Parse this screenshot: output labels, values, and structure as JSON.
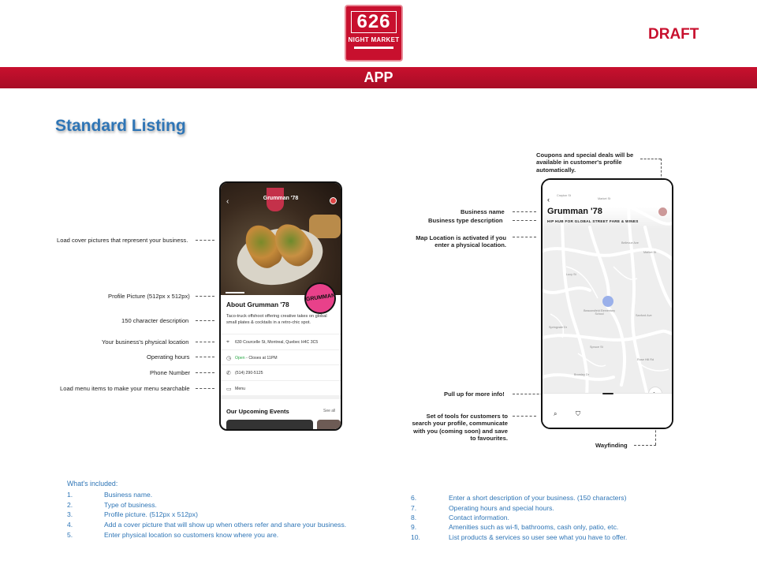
{
  "logo": {
    "number": "626",
    "subtitle": "NIGHT MARKET"
  },
  "draft_label": "DRAFT",
  "band_title": "APP",
  "heading": "Standard Listing",
  "left_callouts": [
    "Load cover pictures that represent your business.",
    "Profile Picture (512px x 512px)",
    "150 character description",
    "Your business's physical location",
    "Operating hours",
    "Phone Number",
    "Load menu items to make your menu searchable"
  ],
  "right_callouts": {
    "coupons": "Coupons and special deals will be available in customer's profile automatically.",
    "business_name": "Business name",
    "business_type": "Business type description",
    "map_location": "Map Location is activated if you enter a physical location.",
    "pull_up": "Pull up for more info!",
    "tools": "Set of tools for customers to search your profile, communicate with you (coming soon) and save to favourites.",
    "wayfinding": "Wayfinding"
  },
  "phone1": {
    "title": "Grumman '78",
    "about_title": "About Grumman '78",
    "description": "Taco-truck offshoot offering creative takes on global small plates & cocktails in a retro-chic spot.",
    "address": "630 Courcelle St, Montreal, Quebec H4C 3C5",
    "hours_status": "Open",
    "hours_detail": " - Closes at 11PM",
    "phone": "(514) 290-5125",
    "menu": "Menu",
    "events_title": "Our Upcoming Events",
    "see_all": "See all",
    "profile_badge": "GRUMMAN"
  },
  "phone2": {
    "business_name": "Grumman '78",
    "business_type": "HIP HUB FOR GLOBAL STREET FARE & WINES",
    "pin_label": "Beaconsfield Elementary School",
    "road_labels": [
      "Crayton St",
      "Market St",
      "Bellevue Ave",
      "Market St",
      "Lucy St",
      "Springvale Dr",
      "Spruce St",
      "Sanford Ave",
      "Rose Hill Rd",
      "Bromley Dr"
    ]
  },
  "included_title": "What's included:",
  "included_left": [
    {
      "n": "1.",
      "t": "Business name."
    },
    {
      "n": "2.",
      "t": "Type of business."
    },
    {
      "n": "3.",
      "t": "Profile picture. (512px x 512px)"
    },
    {
      "n": "4.",
      "t": "Add a cover picture that will show up when others refer and share your business."
    },
    {
      "n": "5.",
      "t": "Enter physical location so customers know where you are."
    }
  ],
  "included_right": [
    {
      "n": "6.",
      "t": "Enter a short description of your business. (150 characters)"
    },
    {
      "n": "7.",
      "t": "Operating hours and special hours."
    },
    {
      "n": "8.",
      "t": "Contact information."
    },
    {
      "n": "9.",
      "t": "Amenities such as wi-fi, bathrooms, cash only, patio, etc."
    },
    {
      "n": "10.",
      "t": "List products & services so user see what you have to offer."
    }
  ],
  "colors": {
    "brand_red": "#c8102e",
    "heading_blue": "#2e75b6",
    "open_green": "#29a745"
  }
}
